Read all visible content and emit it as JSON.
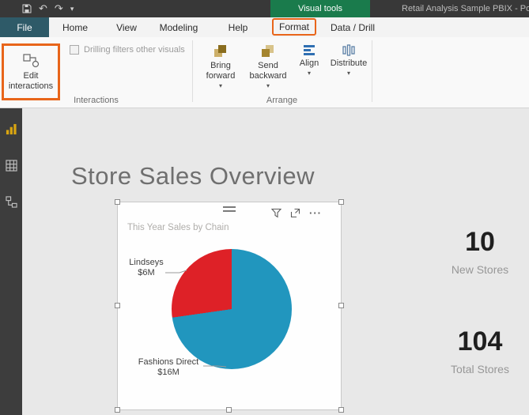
{
  "icons": {
    "undo": "↶",
    "redo": "↷",
    "caret": "▾",
    "ellipsis": "···"
  },
  "titlebar": {
    "contextual_label": "Visual tools",
    "window_title": "Retail Analysis Sample PBIX - Po"
  },
  "ribbon_tabs": {
    "file": "File",
    "home": "Home",
    "view": "View",
    "modeling": "Modeling",
    "help": "Help",
    "format": "Format",
    "data_drill": "Data / Drill"
  },
  "ribbon": {
    "edit_interactions_label": "Edit interactions",
    "drilling_checkbox_label": "Drilling filters other visuals",
    "drilling_checkbox_checked": false,
    "interactions_group_label": "Interactions",
    "arrange_group_label": "Arrange",
    "bring_forward_label": "Bring forward",
    "send_backward_label": "Send backward",
    "align_label": "Align",
    "distribute_label": "Distribute"
  },
  "canvas": {
    "page_title": "Store Sales Overview",
    "kpis": [
      {
        "value": "10",
        "label": "New Stores"
      },
      {
        "value": "104",
        "label": "Total Stores"
      }
    ]
  },
  "chart_data": {
    "type": "pie",
    "title": "This Year Sales by Chain",
    "labels": [
      "Fashions Direct",
      "Lindseys"
    ],
    "values": [
      16,
      6
    ],
    "value_labels": [
      "$16M",
      "$6M"
    ],
    "colors": [
      "#2196be",
      "#de2127"
    ],
    "legend": "none",
    "data_labels": "category and value, with leader lines"
  },
  "colors": {
    "highlight_orange": "#e8651a",
    "contextual_green": "#1a7b4c",
    "pie_blue": "#2196be",
    "pie_red": "#de2127",
    "rail_selected_gold": "#d9a511"
  }
}
